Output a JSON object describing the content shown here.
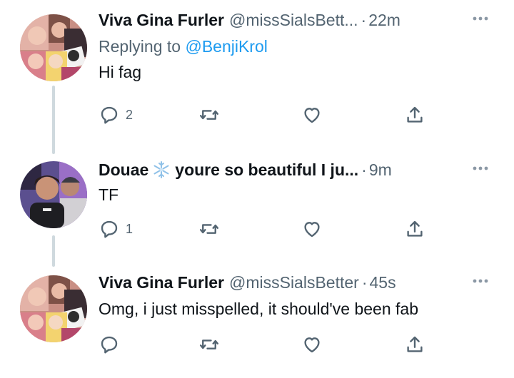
{
  "tweets": [
    {
      "display_name": "Viva Gina Furler",
      "handle": "@missSialsBett...",
      "dot": "·",
      "time": "22m",
      "replying_prefix": "Replying to ",
      "replying_to": "@BenjiKrol",
      "text": "Hi fag",
      "reply_count": "2"
    },
    {
      "display_name": "Douae",
      "name_suffix": "youre so beautiful I ju...",
      "dot": "·",
      "time": "9m",
      "text": "TF",
      "reply_count": "1"
    },
    {
      "display_name": "Viva Gina Furler",
      "handle": "@missSialsBetter",
      "dot": "·",
      "time": "45s",
      "text": "Omg, i just misspelled, it should've been fab",
      "reply_count": ""
    }
  ],
  "icons": {
    "reply": "reply-icon",
    "retweet": "retweet-icon",
    "like": "heart-icon",
    "share": "share-icon",
    "more": "more-icon"
  },
  "colors": {
    "text": "#0f1419",
    "secondary": "#536471",
    "link": "#1d9bf0",
    "thread_line": "#cfd9de"
  }
}
